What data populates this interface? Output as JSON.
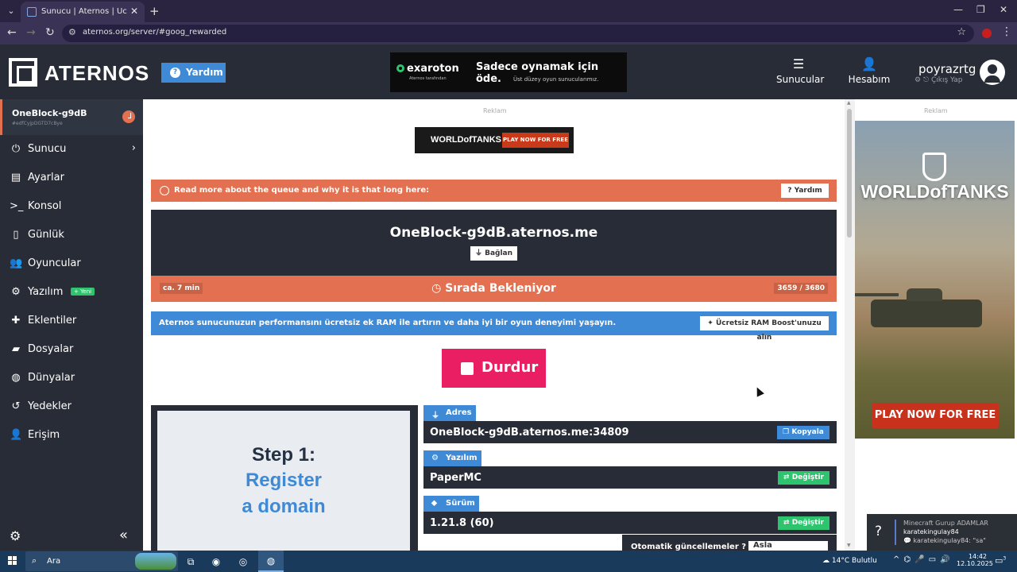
{
  "browser": {
    "tab_title": "Sunucu | Aternos | Ücretsiz Minecraft",
    "tab_close": "✕",
    "new_tab": "+",
    "url": "aternos.org/server/#goog_rewarded",
    "window_controls": [
      "—",
      "❐",
      "✕"
    ]
  },
  "header": {
    "logo": "ATERNOS",
    "help_label": "Yardım",
    "ad": {
      "brand": "exaroton",
      "brand_sub": "Aternos tarafından",
      "headline": "Sadece oynamak için ödе.",
      "subline": "Üst düzey oyun sunucularımız."
    },
    "servers_label": "Sunucular",
    "account_label": "Hesabım",
    "username": "poyrazrtg",
    "logout_label": "Çıkış Yap"
  },
  "sidebar": {
    "server_name": "OneBlock-g9dB",
    "server_id": "#edfCyjpDGTD7cBye",
    "items": [
      {
        "label": "Sunucu",
        "icon": "power-icon"
      },
      {
        "label": "Ayarlar",
        "icon": "sliders-icon"
      },
      {
        "label": "Konsol",
        "icon": "terminal-icon"
      },
      {
        "label": "Günlük",
        "icon": "log-icon"
      },
      {
        "label": "Oyuncular",
        "icon": "users-icon"
      },
      {
        "label": "Yazılım",
        "icon": "cogs-icon",
        "badge": "+ Yeni"
      },
      {
        "label": "Eklentiler",
        "icon": "puzzle-icon"
      },
      {
        "label": "Dosyalar",
        "icon": "folder-icon"
      },
      {
        "label": "Dünyalar",
        "icon": "globe-icon"
      },
      {
        "label": "Yedekler",
        "icon": "history-icon"
      },
      {
        "label": "Erişim",
        "icon": "user-lock-icon"
      }
    ]
  },
  "main": {
    "ad_label": "Reklam",
    "wot_small": {
      "title": "WORLDofTANKS",
      "cta": "PLAY NOW FOR FREE"
    },
    "queue_notice": "Read more about the queue and why it is that long here:",
    "queue_help": "Yardım",
    "server_address": "OneBlock-g9dB.aternos.me",
    "connect_label": "Bağlan",
    "eta": "ca. 7 min",
    "status": "Sırada Bekleniyor",
    "queue_position": "3659 / 3680",
    "ram_notice": "Aternos sunucunuzun performansını ücretsiz ek RAM ile artırın ve daha iyi bir oyun deneyimi yaşayın.",
    "ram_button": "Ücretsiz RAM Boost'unuzu alın",
    "stop_label": "Durdur",
    "step": {
      "line1": "Step 1:",
      "line2": "Register",
      "line3": "a domain"
    },
    "address_tag": "Adres",
    "address_value": "OneBlock-g9dB.aternos.me:34809",
    "copy_label": "Kopyala",
    "software_tag": "Yazılım",
    "software_value": "PaperMC",
    "change_label": "Değiştir",
    "version_tag": "Sürüm",
    "version_value": "1.21.8 (60)",
    "auto_update_label": "Otomatik güncellemeler",
    "auto_update_value": "Asla"
  },
  "right_ad": {
    "label": "Reklam",
    "title": "WORLDofTANKS",
    "cta": "PLAY NOW FOR FREE"
  },
  "notification": {
    "title": "Minecraft Gurup ADAMLAR",
    "sender": "karatekingulay84",
    "message": "karatekingulay84: \"sa\""
  },
  "taskbar": {
    "search": "Ara",
    "weather": "14°C  Bulutlu",
    "time": "14:42",
    "date": "12.10.2025",
    "notification_count": "3"
  },
  "colors": {
    "dark": "#272c36",
    "queue_orange": "#e37050",
    "accent_blue": "#3e8ad6",
    "stop_pink": "#e91e63",
    "change_green": "#2ec46d"
  }
}
